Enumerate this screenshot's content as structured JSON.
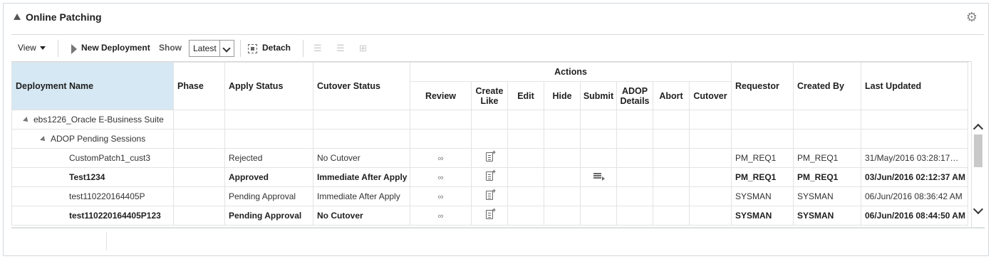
{
  "panel": {
    "title": "Online Patching"
  },
  "toolbar": {
    "view_label": "View",
    "new_deployment_label": "New Deployment",
    "show_label": "Show",
    "show_value": "Latest",
    "detach_label": "Detach"
  },
  "table": {
    "headers": {
      "deployment_name": "Deployment Name",
      "phase": "Phase",
      "apply_status": "Apply Status",
      "cutover_status": "Cutover Status",
      "actions": "Actions",
      "review": "Review",
      "create_like": "Create Like",
      "edit": "Edit",
      "hide": "Hide",
      "submit": "Submit",
      "adop_details": "ADOP Details",
      "abort": "Abort",
      "cutover": "Cutover",
      "requestor": "Requestor",
      "created_by": "Created By",
      "last_updated": "Last Updated"
    },
    "groups": {
      "root": "ebs1226_Oracle E-Business Suite",
      "child": "ADOP Pending Sessions"
    },
    "rows": [
      {
        "name": "CustomPatch1_cust3",
        "apply_status": "Rejected",
        "cutover_status": "No Cutover",
        "requestor": "PM_REQ1",
        "created_by": "PM_REQ1",
        "last_updated": "31/May/2016 03:28:17…",
        "bold": false,
        "submit": false
      },
      {
        "name": "Test1234",
        "apply_status": "Approved",
        "cutover_status": "Immediate After Apply",
        "requestor": "PM_REQ1",
        "created_by": "PM_REQ1",
        "last_updated": "03/Jun/2016 02:12:37 AM",
        "bold": true,
        "submit": true
      },
      {
        "name": "test110220164405P",
        "apply_status": "Pending Approval",
        "cutover_status": "Immediate After Apply",
        "requestor": "SYSMAN",
        "created_by": "SYSMAN",
        "last_updated": "06/Jun/2016 08:36:42 AM",
        "bold": false,
        "submit": false
      },
      {
        "name": "test110220164405P123",
        "apply_status": "Pending Approval",
        "cutover_status": "No Cutover",
        "requestor": "SYSMAN",
        "created_by": "SYSMAN",
        "last_updated": "06/Jun/2016 08:44:50 AM",
        "bold": true,
        "submit": false
      }
    ]
  },
  "icons": {
    "gear": "gear-icon",
    "review": "glasses-icon",
    "create_like": "document-add-icon",
    "submit": "submit-icon"
  }
}
